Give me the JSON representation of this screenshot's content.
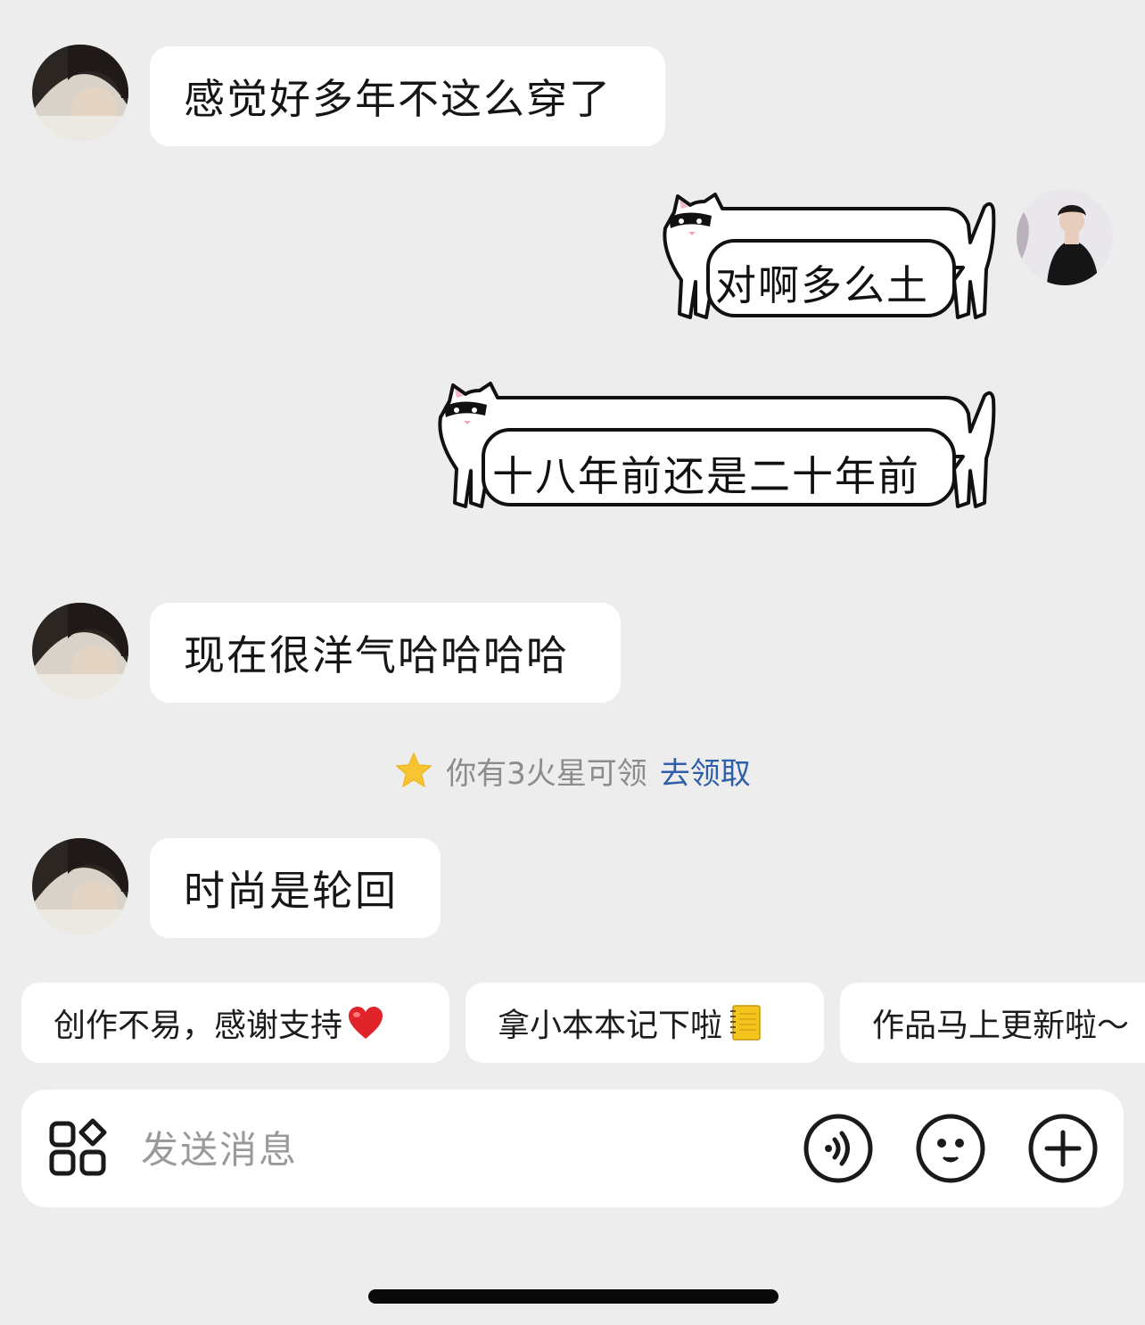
{
  "messages": [
    {
      "side": "left",
      "type": "text",
      "text": "感觉好多年不这么穿了"
    },
    {
      "side": "right",
      "type": "sticker",
      "text": "对啊多么土"
    },
    {
      "side": "right",
      "type": "sticker",
      "text": "十八年前还是二十年前"
    },
    {
      "side": "left",
      "type": "text",
      "text": "现在很洋气哈哈哈哈"
    },
    {
      "side": "left",
      "type": "text",
      "text": "时尚是轮回"
    }
  ],
  "notice": {
    "text": "你有3火星可领",
    "link": "去领取",
    "icon": "star-icon"
  },
  "quick_replies": [
    {
      "text": "创作不易，感谢支持",
      "emoji": "red-heart-icon"
    },
    {
      "text": "拿小本本记下啦",
      "emoji": "notebook-icon"
    },
    {
      "text": "作品马上更新啦～",
      "emoji": ""
    }
  ],
  "input": {
    "placeholder": "发送消息",
    "value": ""
  },
  "toolbar": {
    "icons": [
      "apps-grid-icon",
      "voice-icon",
      "emoji-icon",
      "plus-icon"
    ]
  },
  "colors": {
    "background": "#ededed",
    "bubble": "#ffffff",
    "link": "#2f5fa8",
    "muted_text": "#8c8c8c"
  }
}
